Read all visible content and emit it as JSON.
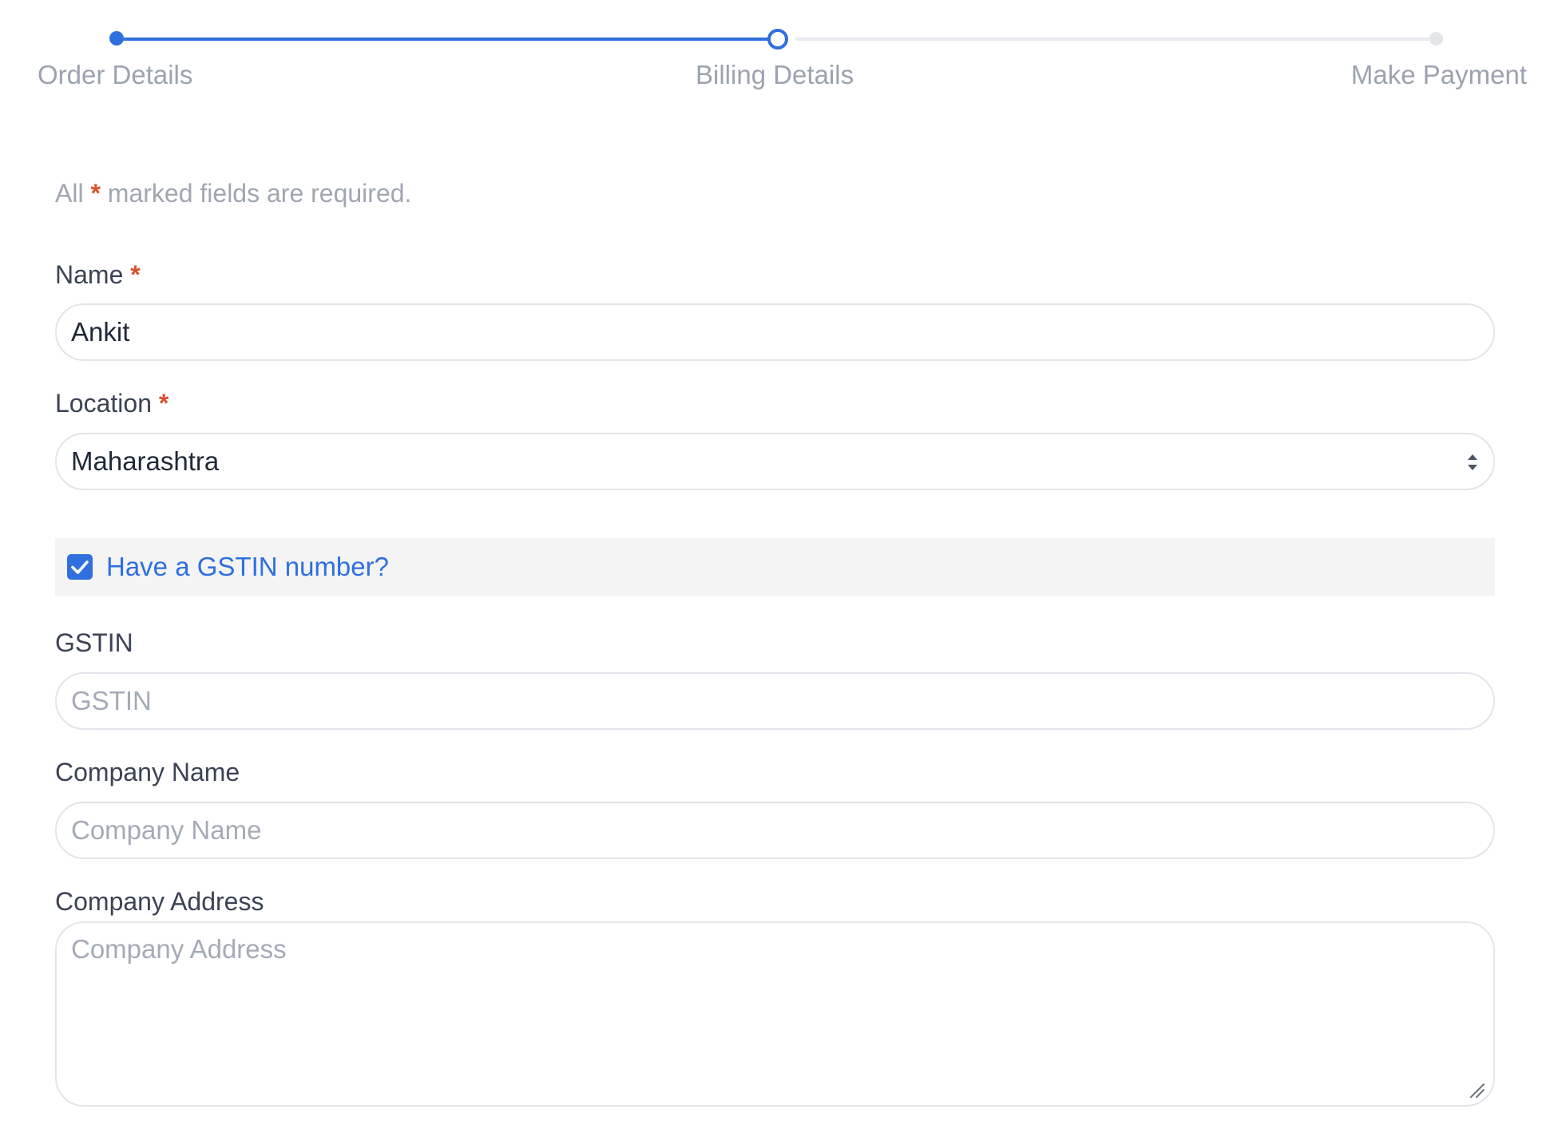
{
  "stepper": {
    "steps": [
      {
        "label": "Order Details",
        "state": "done"
      },
      {
        "label": "Billing Details",
        "state": "current"
      },
      {
        "label": "Make Payment",
        "state": "todo"
      }
    ],
    "active_color": "#2f6fde",
    "inactive_color": "#e8eaee"
  },
  "form": {
    "required_note": {
      "prefix": "All",
      "asterisk": "*",
      "suffix": "marked fields are required."
    },
    "name": {
      "label": "Name",
      "required_mark": "*",
      "value": "Ankit",
      "placeholder": ""
    },
    "location": {
      "label": "Location",
      "required_mark": "*",
      "selected": "Maharashtra",
      "icon": "select-arrows-icon"
    },
    "gstin_toggle": {
      "label": "Have a GSTIN number?",
      "checked": true,
      "icon": "check-icon"
    },
    "gstin": {
      "label": "GSTIN",
      "value": "",
      "placeholder": "GSTIN"
    },
    "company_name": {
      "label": "Company Name",
      "value": "",
      "placeholder": "Company Name"
    },
    "company_address": {
      "label": "Company Address",
      "value": "",
      "placeholder": "Company Address",
      "icon": "resize-handle-icon"
    }
  },
  "colors": {
    "accent": "#2f6fde",
    "required": "#d9512c",
    "muted_text": "#9ca3af",
    "label_text": "#3b4354",
    "border": "#e2e5ea"
  }
}
